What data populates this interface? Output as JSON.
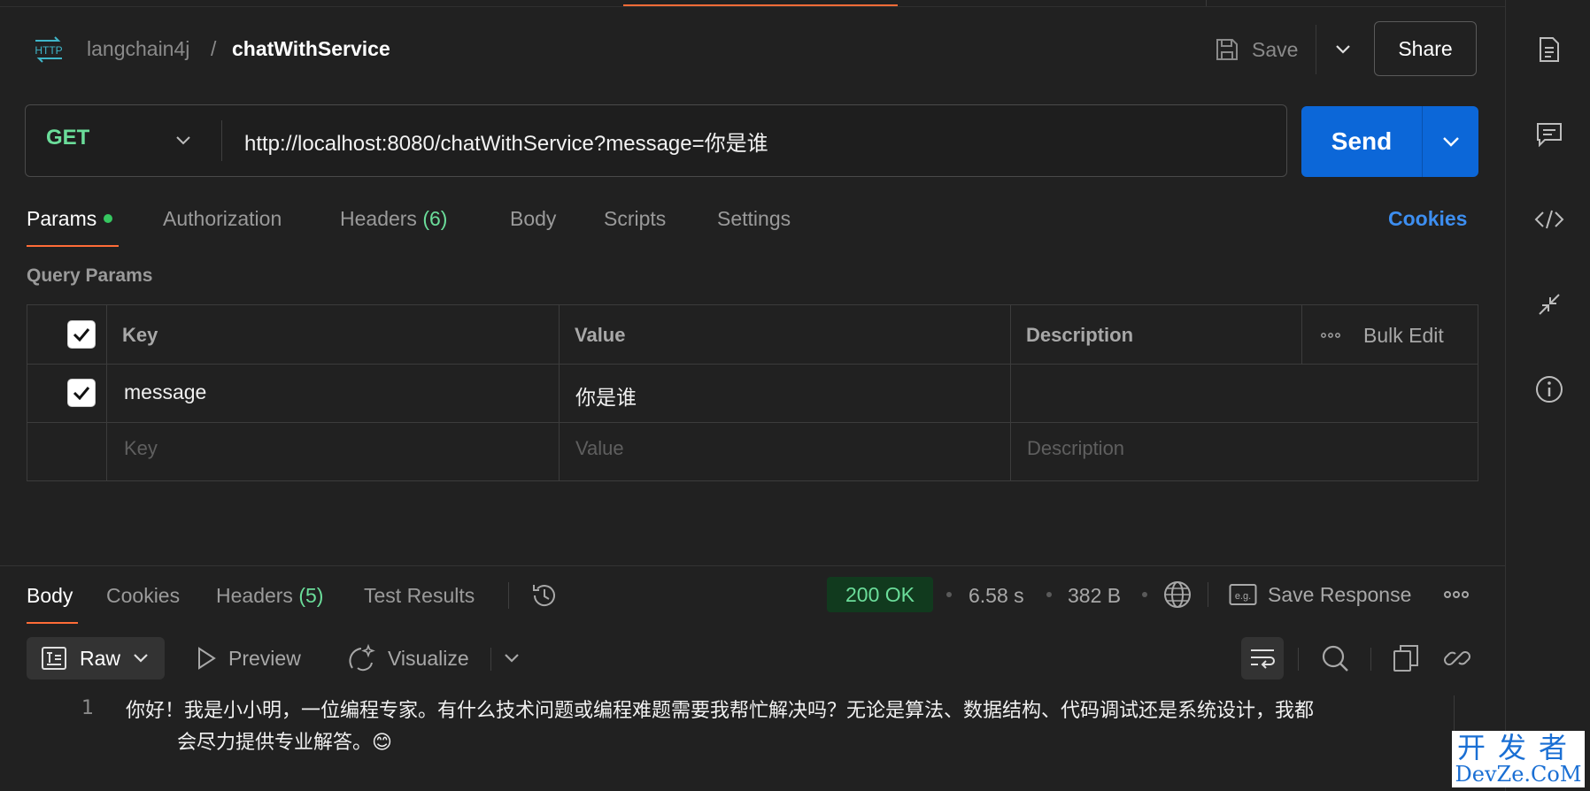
{
  "header": {
    "breadcrumb_parent": "langchain4j",
    "breadcrumb_sep": "/",
    "title": "chatWithService",
    "save_label": "Save",
    "share_label": "Share"
  },
  "request": {
    "method": "GET",
    "url": "http://localhost:8080/chatWithService?message=你是谁",
    "send_label": "Send"
  },
  "request_tabs": {
    "params": "Params",
    "authorization": "Authorization",
    "headers": "Headers",
    "headers_count": "(6)",
    "body": "Body",
    "scripts": "Scripts",
    "settings": "Settings",
    "cookies": "Cookies"
  },
  "query_params": {
    "title": "Query Params",
    "columns": {
      "key": "Key",
      "value": "Value",
      "description": "Description"
    },
    "bulk_edit": "Bulk Edit",
    "rows": [
      {
        "checked": true,
        "key": "message",
        "value": "你是谁",
        "description": ""
      }
    ],
    "placeholders": {
      "key": "Key",
      "value": "Value",
      "description": "Description"
    }
  },
  "response": {
    "tabs": {
      "body": "Body",
      "cookies": "Cookies",
      "headers": "Headers",
      "headers_count": "(5)",
      "test_results": "Test Results"
    },
    "status": "200 OK",
    "time": "6.58 s",
    "size": "382 B",
    "save_response": "Save Response",
    "format": "Raw",
    "preview": "Preview",
    "visualize": "Visualize",
    "line_number": "1",
    "line1": "你好！我是小小明，一位编程专家。有什么技术问题或编程难题需要我帮忙解决吗？无论是算法、数据结构、代码调试还是系统设计，我都",
    "line1_cont": "会尽力提供专业解答。😊"
  },
  "watermark": {
    "top": "开发者",
    "bottom": "DevZe.CoM"
  },
  "colors": {
    "accent": "#ff6c37",
    "send": "#0c67d8",
    "method": "#6bdd9a",
    "link": "#3d8ef0",
    "status_bg": "#113a1e"
  },
  "icons": [
    "http-icon",
    "save-icon",
    "chevron-down-icon",
    "document-icon",
    "comment-icon",
    "code-icon",
    "compress-icon",
    "info-icon",
    "checkmark-icon",
    "more-icon",
    "history-icon",
    "globe-icon",
    "save-response-icon",
    "raw-icon",
    "play-icon",
    "visualize-icon",
    "wrap-icon",
    "search-icon",
    "copy-icon",
    "link-icon"
  ]
}
